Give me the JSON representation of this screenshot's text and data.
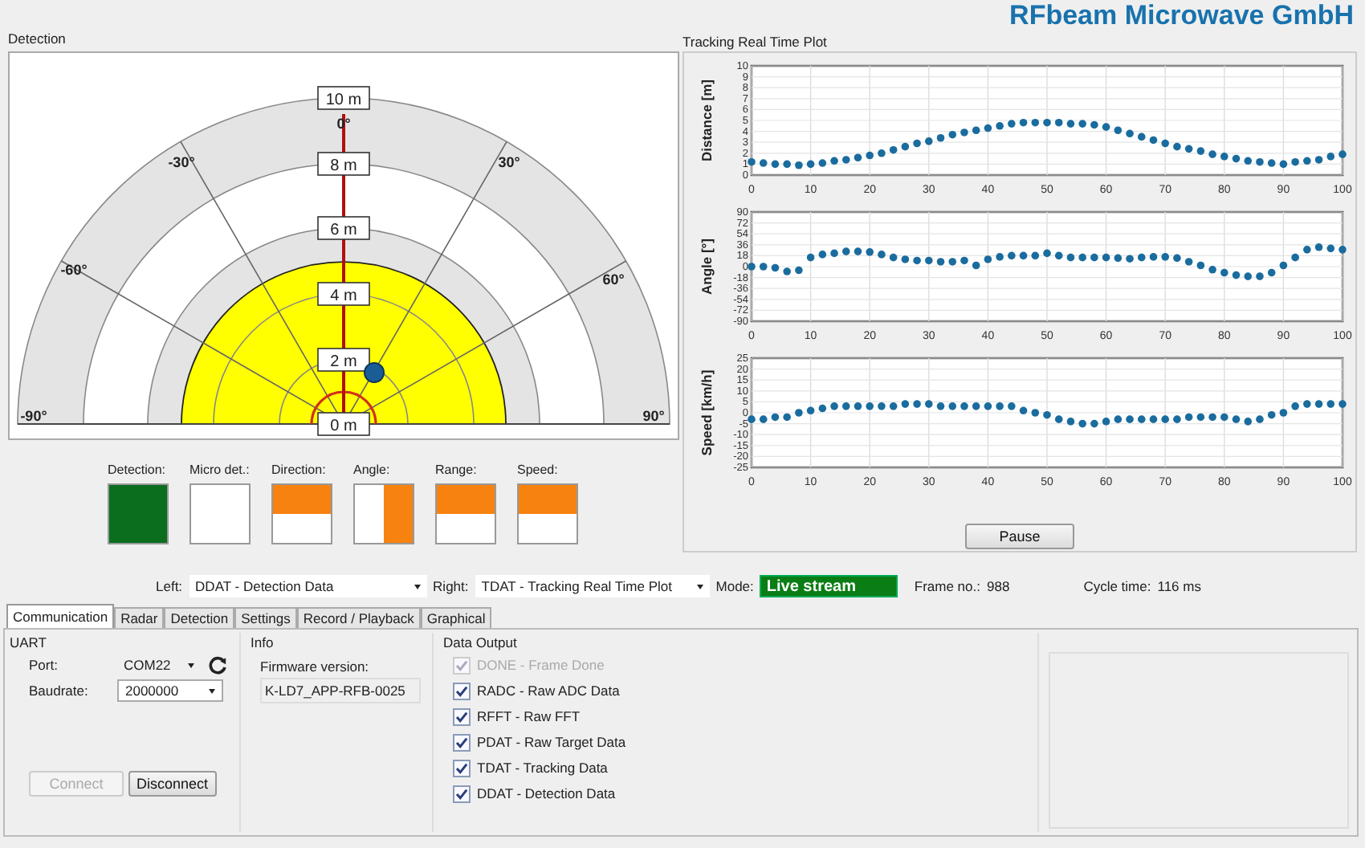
{
  "brand": "RFbeam Microwave GmbH",
  "detection": {
    "title": "Detection",
    "range_labels": [
      "10 m",
      "8 m",
      "6 m",
      "4 m",
      "2 m",
      "0 m"
    ],
    "angle_labels": [
      "0°",
      "-30°",
      "30°",
      "-60°",
      "60°",
      "-90°",
      "90°"
    ],
    "indicators": [
      {
        "label": "Detection:",
        "kind": "full",
        "color": "#0a6e1e"
      },
      {
        "label": "Micro det.:",
        "kind": "empty"
      },
      {
        "label": "Direction:",
        "kind": "top",
        "color": "#f7820f"
      },
      {
        "label": "Angle:",
        "kind": "right",
        "color": "#f7820f"
      },
      {
        "label": "Range:",
        "kind": "top",
        "color": "#f7820f"
      },
      {
        "label": "Speed:",
        "kind": "top",
        "color": "#f7820f"
      }
    ]
  },
  "tracking": {
    "title": "Tracking Real Time Plot",
    "charts": [
      {
        "chart_data": {
          "type": "scatter",
          "ylabel": "Distance [m]",
          "x": [
            0,
            2,
            4,
            6,
            8,
            10,
            12,
            14,
            16,
            18,
            20,
            22,
            24,
            26,
            28,
            30,
            32,
            34,
            36,
            38,
            40,
            42,
            44,
            46,
            48,
            50,
            52,
            54,
            56,
            58,
            60,
            62,
            64,
            66,
            68,
            70,
            72,
            74,
            76,
            78,
            80,
            82,
            84,
            86,
            88,
            90,
            92,
            94,
            96,
            98,
            100
          ],
          "xlim": [
            0,
            100
          ],
          "ylim": [
            0,
            10
          ],
          "xticks": [
            0,
            10,
            20,
            30,
            40,
            50,
            60,
            70,
            80,
            90,
            100
          ],
          "yticks": [
            0,
            1,
            2,
            3,
            4,
            5,
            6,
            7,
            8,
            9,
            10
          ],
          "grid": true,
          "series": [
            {
              "color": "#1a6c9e",
              "values": [
                1.2,
                1.1,
                1.0,
                1.0,
                0.9,
                1.0,
                1.1,
                1.3,
                1.4,
                1.6,
                1.8,
                2.0,
                2.3,
                2.6,
                2.9,
                3.1,
                3.4,
                3.7,
                3.9,
                4.1,
                4.3,
                4.5,
                4.7,
                4.8,
                4.8,
                4.8,
                4.8,
                4.7,
                4.7,
                4.6,
                4.4,
                4.1,
                3.8,
                3.5,
                3.2,
                2.9,
                2.6,
                2.4,
                2.2,
                1.9,
                1.7,
                1.5,
                1.3,
                1.2,
                1.1,
                1.0,
                1.2,
                1.3,
                1.4,
                1.7,
                1.9
              ]
            }
          ]
        }
      },
      {
        "chart_data": {
          "type": "scatter",
          "ylabel": "Angle [°]",
          "x": [
            0,
            2,
            4,
            6,
            8,
            10,
            12,
            14,
            16,
            18,
            20,
            22,
            24,
            26,
            28,
            30,
            32,
            34,
            36,
            38,
            40,
            42,
            44,
            46,
            48,
            50,
            52,
            54,
            56,
            58,
            60,
            62,
            64,
            66,
            68,
            70,
            72,
            74,
            76,
            78,
            80,
            82,
            84,
            86,
            88,
            90,
            92,
            94,
            96,
            98,
            100
          ],
          "xlim": [
            0,
            100
          ],
          "ylim": [
            -90,
            90
          ],
          "xticks": [
            0,
            10,
            20,
            30,
            40,
            50,
            60,
            70,
            80,
            90,
            100
          ],
          "yticks": [
            -90,
            -72,
            -54,
            -36,
            -18,
            0,
            18,
            36,
            54,
            72,
            90
          ],
          "grid": true,
          "series": [
            {
              "color": "#1a6c9e",
              "values": [
                0,
                0,
                -2,
                -8,
                -6,
                15,
                20,
                22,
                25,
                25,
                24,
                20,
                15,
                12,
                10,
                10,
                8,
                8,
                10,
                2,
                12,
                16,
                18,
                18,
                18,
                22,
                18,
                15,
                15,
                15,
                15,
                14,
                13,
                15,
                16,
                16,
                14,
                8,
                2,
                -5,
                -10,
                -14,
                -16,
                -16,
                -10,
                2,
                15,
                28,
                32,
                30,
                28
              ]
            }
          ]
        }
      },
      {
        "chart_data": {
          "type": "scatter",
          "ylabel": "Speed [km/h]",
          "x": [
            0,
            2,
            4,
            6,
            8,
            10,
            12,
            14,
            16,
            18,
            20,
            22,
            24,
            26,
            28,
            30,
            32,
            34,
            36,
            38,
            40,
            42,
            44,
            46,
            48,
            50,
            52,
            54,
            56,
            58,
            60,
            62,
            64,
            66,
            68,
            70,
            72,
            74,
            76,
            78,
            80,
            82,
            84,
            86,
            88,
            90,
            92,
            94,
            96,
            98,
            100
          ],
          "xlim": [
            0,
            100
          ],
          "ylim": [
            -25,
            25
          ],
          "xticks": [
            0,
            10,
            20,
            30,
            40,
            50,
            60,
            70,
            80,
            90,
            100
          ],
          "yticks": [
            -25,
            -20,
            -15,
            -10,
            -5,
            0,
            5,
            10,
            15,
            20,
            25
          ],
          "grid": true,
          "series": [
            {
              "color": "#1a6c9e",
              "values": [
                -3,
                -3,
                -2,
                -2,
                0,
                1,
                2,
                3,
                3,
                3,
                3,
                3,
                3,
                4,
                4,
                4,
                3,
                3,
                3,
                3,
                3,
                3,
                3,
                1,
                0,
                -1,
                -3,
                -4,
                -5,
                -5,
                -4,
                -3,
                -3,
                -3,
                -3,
                -3,
                -3,
                -2,
                -2,
                -2,
                -2,
                -3,
                -4,
                -3,
                -1,
                0,
                3,
                4,
                4,
                4,
                4
              ]
            }
          ]
        }
      }
    ],
    "pause_button": "Pause"
  },
  "controls": {
    "left_label": "Left:",
    "left_value": "DDAT - Detection Data",
    "right_label": "Right:",
    "right_value": "TDAT - Tracking Real Time Plot",
    "mode_label": "Mode:",
    "mode_value": "Live stream",
    "frame_label": "Frame no.:",
    "frame_value": "988",
    "cycle_label": "Cycle time:",
    "cycle_value": "116 ms"
  },
  "tabs": [
    {
      "label": "Communication",
      "selected": true
    },
    {
      "label": "Radar",
      "selected": false
    },
    {
      "label": "Detection",
      "selected": false
    },
    {
      "label": "Settings",
      "selected": false
    },
    {
      "label": "Record / Playback",
      "selected": false
    },
    {
      "label": "Graphical",
      "selected": false
    }
  ],
  "uart": {
    "title": "UART",
    "port_label": "Port:",
    "port_value": "COM22",
    "baud_label": "Baudrate:",
    "baud_value": "2000000",
    "buttons": [
      {
        "label": "Connect",
        "disabled": true
      },
      {
        "label": "Disconnect",
        "disabled": false
      }
    ]
  },
  "info": {
    "title": "Info",
    "firmware_label": "Firmware version:",
    "firmware_value": "K-LD7_APP-RFB-0025"
  },
  "data_output": {
    "title": "Data Output",
    "items": [
      {
        "label": "DONE - Frame Done",
        "checked": true,
        "disabled": true
      },
      {
        "label": "RADC - Raw ADC Data",
        "checked": true,
        "disabled": false
      },
      {
        "label": "RFFT - Raw FFT",
        "checked": true,
        "disabled": false
      },
      {
        "label": "PDAT - Raw Target Data",
        "checked": true,
        "disabled": false
      },
      {
        "label": "TDAT - Tracking Data",
        "checked": true,
        "disabled": false
      },
      {
        "label": "DDAT - Detection Data",
        "checked": true,
        "disabled": false
      }
    ]
  }
}
